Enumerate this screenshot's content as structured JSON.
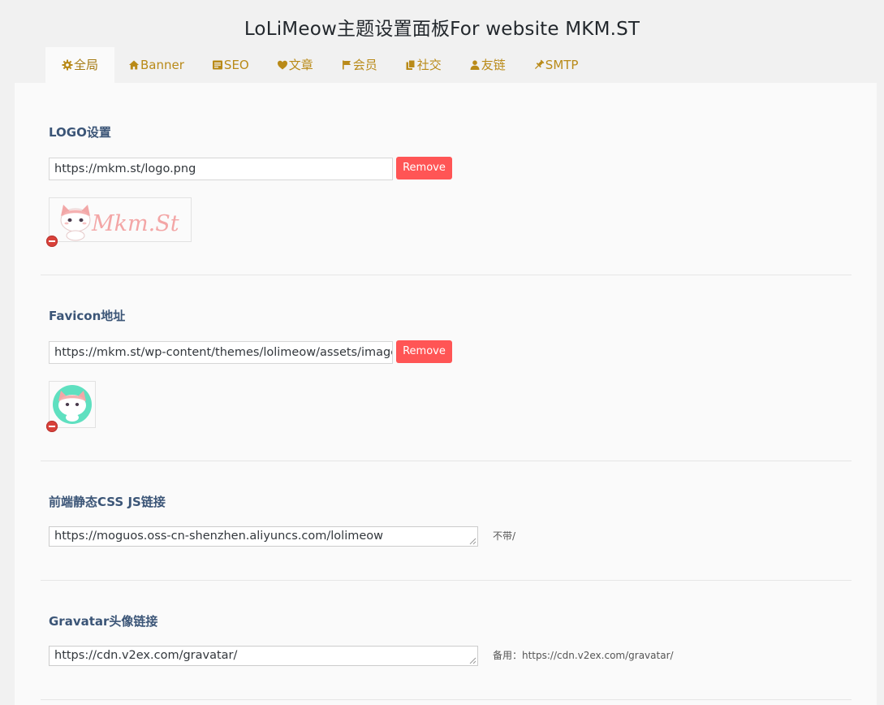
{
  "page": {
    "title": "LoLiMeow主题设置面板For website MKM.ST"
  },
  "tabs": [
    {
      "label": "全局",
      "icon": "gear-icon",
      "active": true
    },
    {
      "label": "Banner",
      "icon": "home-icon",
      "active": false
    },
    {
      "label": "SEO",
      "icon": "document-icon",
      "active": false
    },
    {
      "label": "文章",
      "icon": "heart-icon",
      "active": false
    },
    {
      "label": "会员",
      "icon": "flag-icon",
      "active": false
    },
    {
      "label": "社交",
      "icon": "copy-icon",
      "active": false
    },
    {
      "label": "友链",
      "icon": "user-icon",
      "active": false
    },
    {
      "label": "SMTP",
      "icon": "pin-icon",
      "active": false
    }
  ],
  "logo": {
    "label": "LOGO设置",
    "value": "https://mkm.st/logo.png",
    "remove_label": "Remove"
  },
  "favicon": {
    "label": "Favicon地址",
    "value": "https://mkm.st/wp-content/themes/lolimeow/assets/images/favicon.png",
    "remove_label": "Remove"
  },
  "static_cdn": {
    "label": "前端静态CSS JS链接",
    "value": "https://moguos.oss-cn-shenzhen.aliyuncs.com/lolimeow",
    "desc": "不带/"
  },
  "gravatar": {
    "label": "Gravatar头像链接",
    "value": "https://cdn.v2ex.com/gravatar/",
    "desc": "备用：https://cdn.v2ex.com/gravatar/"
  },
  "logo_preview_text": "Mkm.St",
  "colors": {
    "accent": "#b98a18",
    "remove": "#ff5555",
    "label": "#3b5577",
    "panel": "#fafafa",
    "page_bg": "#f1f1f1"
  }
}
